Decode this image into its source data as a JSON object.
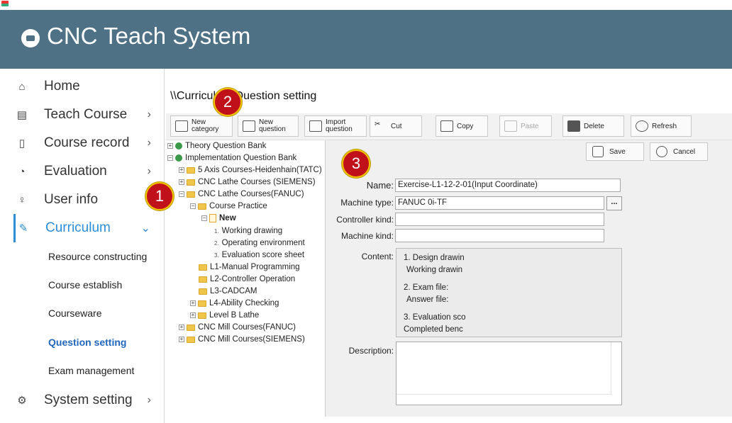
{
  "app": {
    "title": "CNC Teach System"
  },
  "sidebar": {
    "items": [
      {
        "label": "Home",
        "icon": "home-icon"
      },
      {
        "label": "Teach Course",
        "icon": "book-icon"
      },
      {
        "label": "Course record",
        "icon": "record-icon"
      },
      {
        "label": "Evaluation",
        "icon": "chart-icon"
      },
      {
        "label": "User info",
        "icon": "user-icon"
      },
      {
        "label": "Curriculum",
        "icon": "pencil-icon"
      },
      {
        "label": "System setting",
        "icon": "gear-icon"
      }
    ],
    "sub_items": [
      "Resource constructing",
      "Course establish",
      "Courseware",
      "Question setting",
      "Exam management"
    ]
  },
  "main": {
    "breadcrumb": "\\\\Curriculum\\Question setting"
  },
  "toolbar": {
    "new_category": [
      "New",
      "category"
    ],
    "new_question": [
      "New",
      "question"
    ],
    "import_question": [
      "Import",
      "question"
    ],
    "cut": "Cut",
    "copy": "Copy",
    "paste": "Paste",
    "delete": "Delete",
    "refresh": "Refresh"
  },
  "tree": {
    "theory": "Theory Question Bank",
    "implementation": "Implementation Question Bank",
    "five_axis": "5 Axis Courses-Heidenhain(TATC)",
    "lathe_siemens": "CNC Lathe Courses (SIEMENS)",
    "lathe_fanuc": "CNC Lathe Courses(FANUC)",
    "course_practice": "Course Practice",
    "new": "New",
    "leaf1": "Working drawing",
    "leaf2": "Operating environment",
    "leaf3": "Evaluation score sheet",
    "l1": "L1-Manual Programming",
    "l2": "L2-Controller Operation",
    "l3": "L3-CADCAM",
    "l4": "L4-Ability Checking",
    "levelb": "Level B Lathe",
    "mill_fanuc": "CNC Mill Courses(FANUC)",
    "mill_siemens": "CNC Mill Courses(SIEMENS)"
  },
  "form": {
    "save": "Save",
    "cancel": "Cancel",
    "name_label": "Name:",
    "name_value": "Exercise-L1-12-2-01(Input Coordinate)",
    "machine_type_label": "Machine type:",
    "machine_type_value": "FANUC 0i-TF",
    "browse": "...",
    "controller_label": "Controller kind:",
    "controller_value": "",
    "machine_kind_label": "Machine kind:",
    "machine_kind_value": "",
    "content_label": "Content:",
    "content_lines": [
      "1. Design drawin",
      "Working drawin",
      "2. Exam file:",
      "Answer file:",
      "3. Evaluation sco",
      "Completed benc"
    ],
    "description_label": "Description:"
  },
  "badges": [
    "1",
    "2",
    "3"
  ],
  "colors": {
    "header": "#4e7185",
    "accent": "#2d8dd8",
    "badge": "#c0101a"
  }
}
